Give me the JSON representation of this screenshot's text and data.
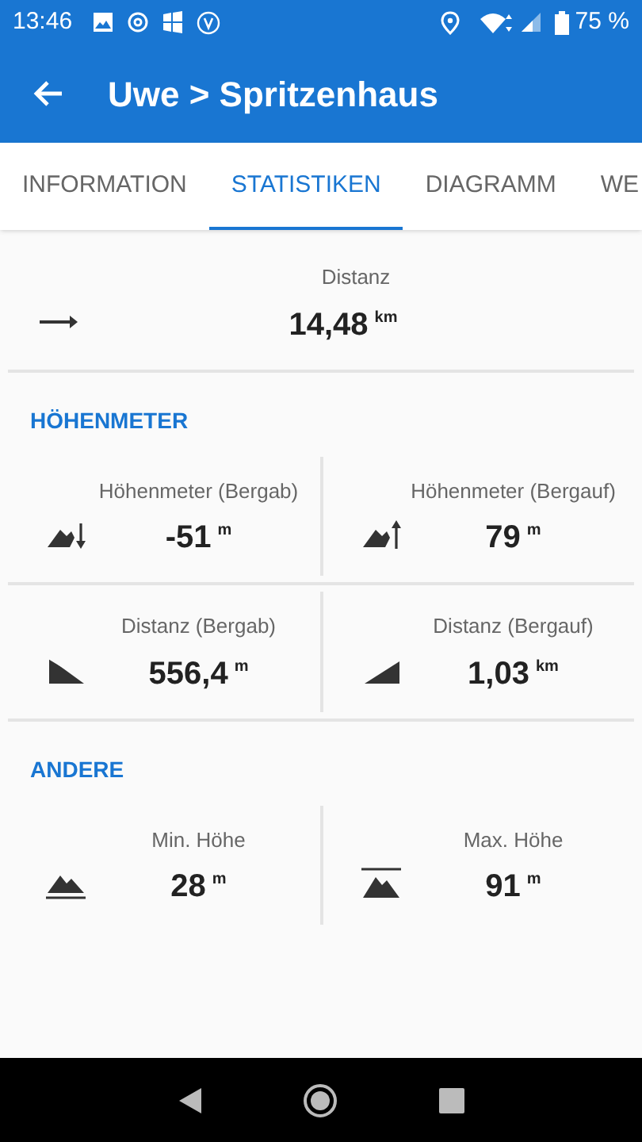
{
  "status_bar": {
    "time": "13:46",
    "battery": "75 %"
  },
  "app_bar": {
    "title": "Uwe > Spritzenhaus"
  },
  "tabs": [
    {
      "label": "INFORMATION",
      "selected": false
    },
    {
      "label": "STATISTIKEN",
      "selected": true
    },
    {
      "label": "DIAGRAMM",
      "selected": false
    },
    {
      "label": "WE",
      "selected": false
    }
  ],
  "distance": {
    "kind": "distance",
    "label": "Distanz",
    "value": "14,48",
    "unit": "km"
  },
  "sections": [
    {
      "title": "HÖHENMETER",
      "rows": [
        [
          {
            "kind": "descent",
            "label": "Höhenmeter (Bergab)",
            "value": "-51",
            "unit": "m"
          },
          {
            "kind": "ascent",
            "label": "Höhenmeter (Bergauf)",
            "value": "79",
            "unit": "m"
          }
        ],
        [
          {
            "kind": "downhill",
            "label": "Distanz (Bergab)",
            "value": "556,4",
            "unit": "m"
          },
          {
            "kind": "uphill",
            "label": "Distanz (Bergauf)",
            "value": "1,03",
            "unit": "km"
          }
        ]
      ]
    },
    {
      "title": "ANDERE",
      "rows": [
        [
          {
            "kind": "min",
            "label": "Min. Höhe",
            "value": "28",
            "unit": "m"
          },
          {
            "kind": "max",
            "label": "Max. Höhe",
            "value": "91",
            "unit": "m"
          }
        ]
      ]
    }
  ]
}
